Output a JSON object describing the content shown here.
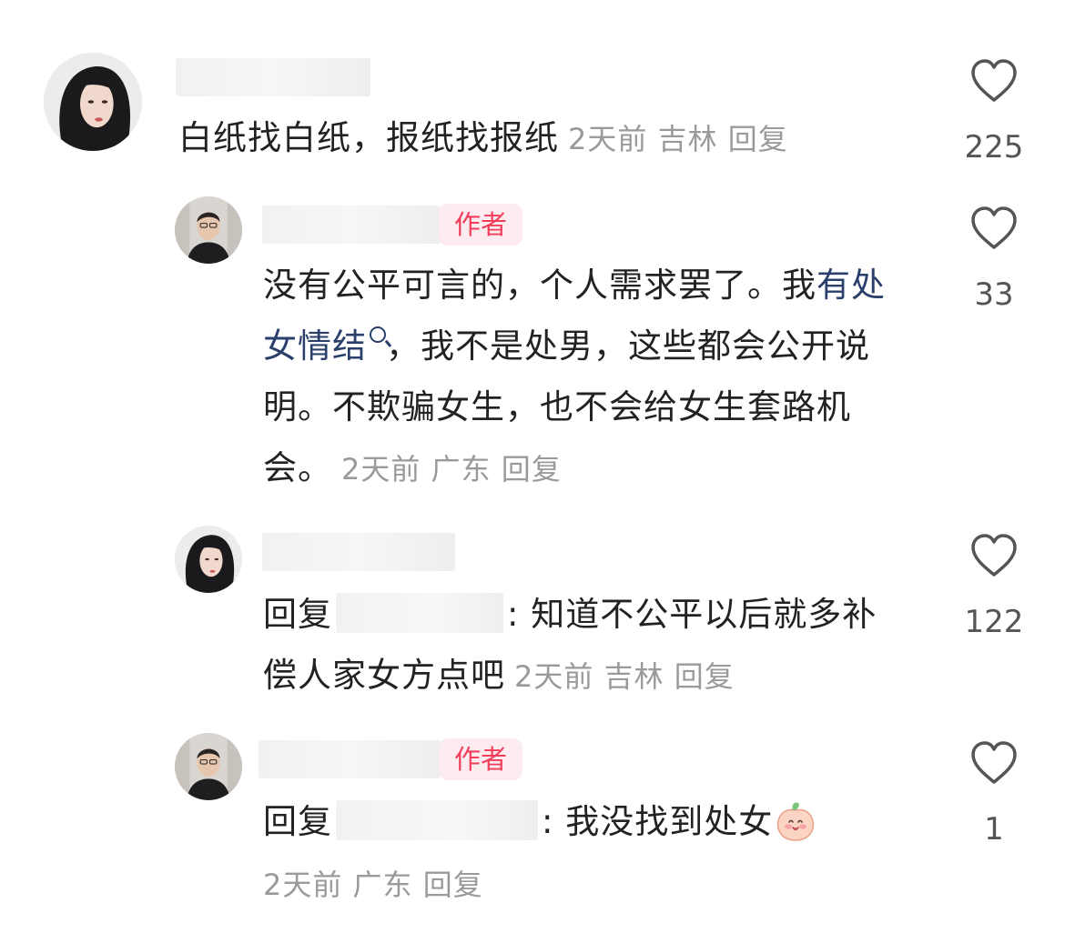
{
  "comments": [
    {
      "text": "白纸找白纸，报纸找报纸",
      "time": "2天前",
      "location": "吉林",
      "reply_label": "回复",
      "likes": "225"
    },
    {
      "is_author": true,
      "author_badge": "作者",
      "text_prefix": "没有公平可言的，个人需求罢了。我",
      "link_text": "有处女情结",
      "text_suffix": "，我不是处男，这些都会公开说明。不欺骗女生，也不会给女生套路机会。",
      "time": "2天前",
      "location": "广东",
      "reply_label": "回复",
      "likes": "33"
    },
    {
      "reply_to_label": "回复",
      "text": ": 知道不公平以后就多补偿人家女方点吧",
      "time": "2天前",
      "location": "吉林",
      "reply_label": "回复",
      "likes": "122"
    },
    {
      "is_author": true,
      "author_badge": "作者",
      "reply_to_label": "回复",
      "text": ": 我没找到处女",
      "emoji": "peach-smile-emoji",
      "time": "2天前",
      "location": "广东",
      "reply_label": "回复",
      "likes": "1"
    }
  ],
  "colors": {
    "author_badge_text": "#f23d5b",
    "author_badge_bg": "#fdecef",
    "link": "#2b3f6b",
    "meta": "#9a9a9a"
  }
}
